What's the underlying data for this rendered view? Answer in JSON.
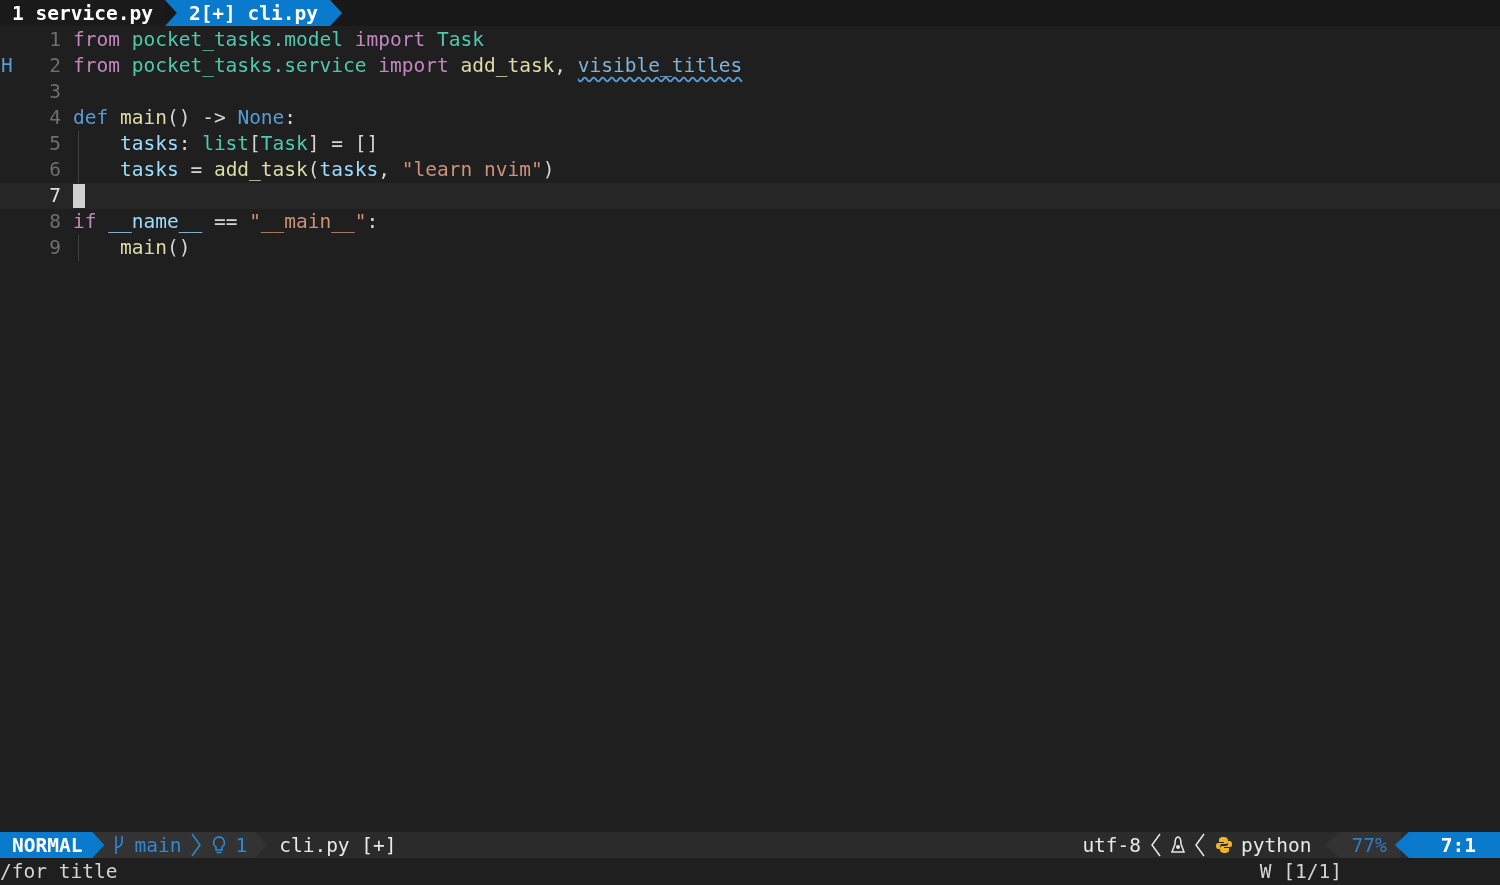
{
  "tabs": [
    {
      "label": "1 service.py",
      "selected": false
    },
    {
      "label": "2[+] cli.py",
      "selected": true
    }
  ],
  "editor": {
    "lines": [
      {
        "number": "1",
        "current": false,
        "guide": false,
        "tokens": [
          {
            "text": "from ",
            "kind": "keyword"
          },
          {
            "text": "pocket_tasks.model ",
            "kind": "type"
          },
          {
            "text": "import ",
            "kind": "keyword"
          },
          {
            "text": "Task",
            "kind": "type"
          }
        ]
      },
      {
        "number": "2",
        "sign": "H",
        "current": false,
        "guide": false,
        "tokens": [
          {
            "text": "from ",
            "kind": "keyword"
          },
          {
            "text": "pocket_tasks.service ",
            "kind": "type"
          },
          {
            "text": "import ",
            "kind": "keyword"
          },
          {
            "text": "add_task",
            "kind": "function"
          },
          {
            "text": ", ",
            "kind": "plain"
          },
          {
            "text": "visible_titles",
            "kind": "hint"
          }
        ]
      },
      {
        "number": "3",
        "current": false,
        "guide": false
      },
      {
        "number": "4",
        "current": false,
        "guide": false,
        "tokens": [
          {
            "text": "def ",
            "kind": "constant"
          },
          {
            "text": "main",
            "kind": "function"
          },
          {
            "text": "() -> ",
            "kind": "plain"
          },
          {
            "text": "None",
            "kind": "constant"
          },
          {
            "text": ":",
            "kind": "plain"
          }
        ]
      },
      {
        "number": "5",
        "current": false,
        "guide": true,
        "tokens": [
          {
            "text": "tasks",
            "kind": "variable"
          },
          {
            "text": ": ",
            "kind": "plain"
          },
          {
            "text": "list",
            "kind": "type"
          },
          {
            "text": "[",
            "kind": "plain"
          },
          {
            "text": "Task",
            "kind": "type"
          },
          {
            "text": "] = []",
            "kind": "plain"
          }
        ]
      },
      {
        "number": "6",
        "current": false,
        "guide": true,
        "tokens": [
          {
            "text": "tasks",
            "kind": "variable"
          },
          {
            "text": " = ",
            "kind": "plain"
          },
          {
            "text": "add_task",
            "kind": "function"
          },
          {
            "text": "(",
            "kind": "plain"
          },
          {
            "text": "tasks",
            "kind": "variable"
          },
          {
            "text": ", ",
            "kind": "plain"
          },
          {
            "text": "\"learn nvim\"",
            "kind": "string"
          },
          {
            "text": ")",
            "kind": "plain"
          }
        ]
      },
      {
        "number": "7",
        "current": true,
        "guide": false
      },
      {
        "number": "8",
        "current": false,
        "guide": false,
        "tokens": [
          {
            "text": "if ",
            "kind": "keyword"
          },
          {
            "text": "__name__",
            "kind": "variable"
          },
          {
            "text": " == ",
            "kind": "plain"
          },
          {
            "text": "\"__main__\"",
            "kind": "string"
          },
          {
            "text": ":",
            "kind": "plain"
          }
        ]
      },
      {
        "number": "9",
        "current": false,
        "guide": true,
        "tokens": [
          {
            "text": "main",
            "kind": "function"
          },
          {
            "text": "()",
            "kind": "plain"
          }
        ]
      }
    ]
  },
  "status_bar": {
    "mode": "NORMAL",
    "branch": "main",
    "diagnostics": "1",
    "file": "cli.py [+]",
    "encoding": "utf-8",
    "filetype": "python",
    "progress": "77%",
    "position": "7:1"
  },
  "command_line": {
    "command": "/for title",
    "search_count": "W [1/1]"
  }
}
